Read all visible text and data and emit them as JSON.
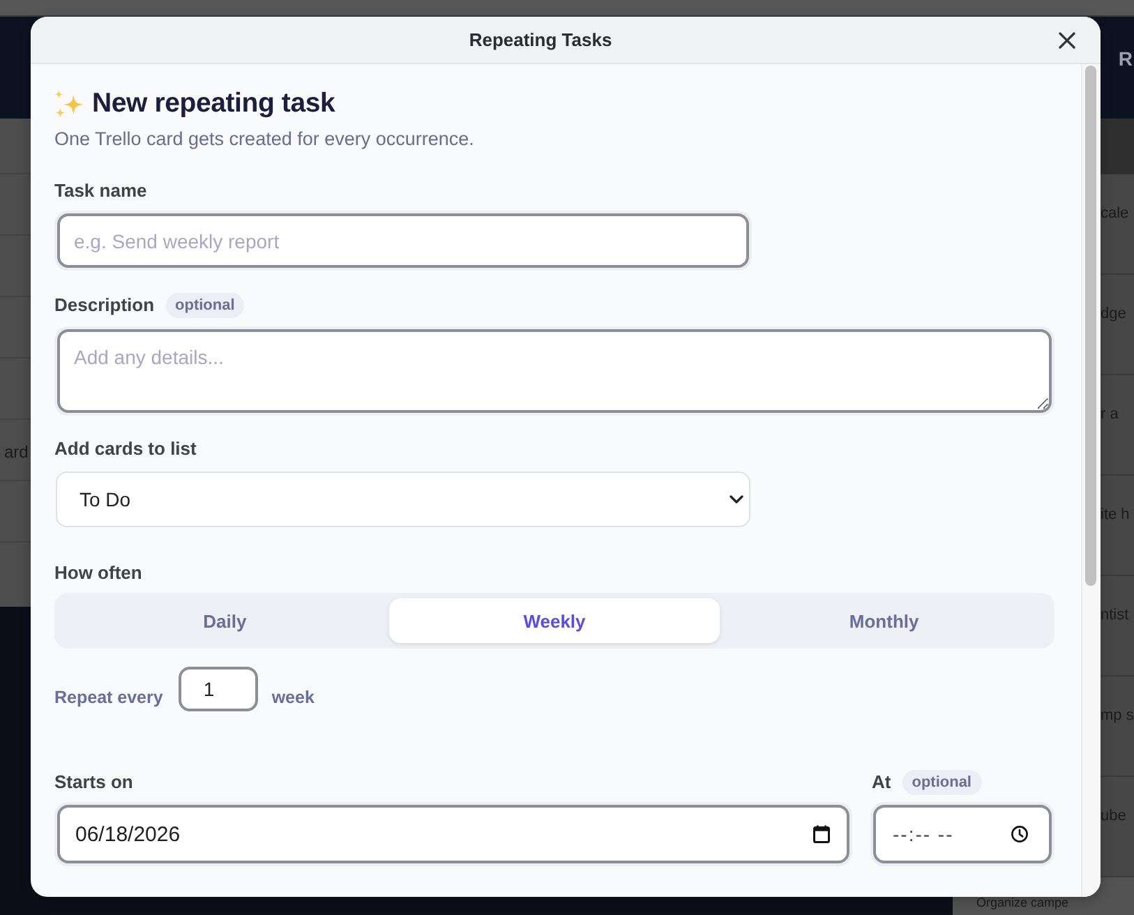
{
  "backdrop": {
    "header_text": "R",
    "left_list": [
      "ard"
    ],
    "cards": [
      "cale",
      "dge",
      "r a",
      "ite h",
      "ntist",
      "mp s",
      "ube"
    ],
    "bottom_card": "Organize campe"
  },
  "dialog": {
    "title": "Repeating Tasks"
  },
  "form": {
    "heading": "New repeating task",
    "subtitle": "One Trello card gets created for every occurrence.",
    "task_name": {
      "label": "Task name",
      "placeholder": "e.g. Send weekly report"
    },
    "description": {
      "label": "Description",
      "badge": "optional",
      "placeholder": "Add any details..."
    },
    "target_list": {
      "label": "Add cards to list",
      "value": "To Do"
    },
    "how_often": {
      "label": "How often",
      "options": [
        {
          "label": "Daily",
          "selected": false
        },
        {
          "label": "Weekly",
          "selected": true
        },
        {
          "label": "Monthly",
          "selected": false
        }
      ]
    },
    "repeat": {
      "label": "Repeat every",
      "value": "1",
      "unit": "week"
    },
    "starts_on": {
      "label": "Starts on",
      "value": "06/18/2026"
    },
    "at": {
      "label": "At",
      "badge": "optional",
      "placeholder": "--:-- --"
    }
  }
}
